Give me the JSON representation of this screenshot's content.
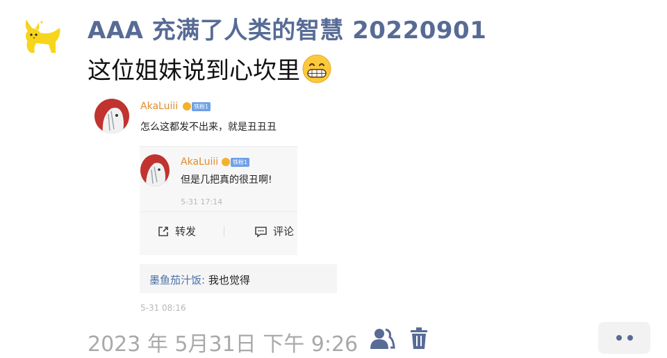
{
  "author": {
    "name": "AAA 充满了人类的智慧 20220901"
  },
  "post": {
    "text": "这位姐妹说到心坎里",
    "emoji": "grinning-face-emoji"
  },
  "screenshot": {
    "comment": {
      "nickname": "AkaLuiii",
      "badge": "铁粉1",
      "text": "怎么这都发不出来，就是丑丑丑"
    },
    "repost": {
      "nickname": "AkaLuiii",
      "badge": "铁粉1",
      "text": "但是几把真的很丑啊!",
      "time": "5-31 17:14",
      "actions": {
        "forward": "转发",
        "comment": "评论"
      }
    },
    "reply": {
      "name": "墨鱼茄汁饭",
      "separator": ": ",
      "text": "我也觉得",
      "time": "5-31 08:16"
    }
  },
  "footer": {
    "timestamp": "2023 年 5月31日 下午 9:26",
    "icons": [
      "friends-icon",
      "trash-icon",
      "more-icon"
    ]
  },
  "colors": {
    "link": "#576b95",
    "nickname": "#e08a2c",
    "timestamp": "#a9a9a9"
  }
}
